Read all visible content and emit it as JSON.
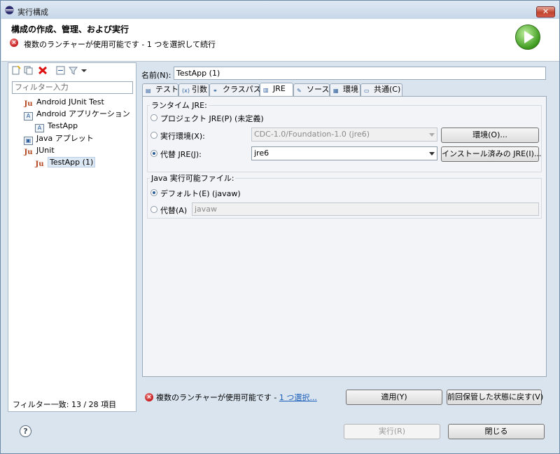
{
  "window": {
    "title": "実行構成",
    "close_glyph": "✕"
  },
  "header": {
    "title": "構成の作成、管理、および実行",
    "message": "複数のランチャーが使用可能です - 1 つを選択して続行"
  },
  "sidebar": {
    "filter_placeholder": "フィルター入力",
    "items": [
      {
        "label": "Android JUnit Test",
        "icon": "junit-icon"
      },
      {
        "label": "Android アプリケーション",
        "icon": "android-app-icon"
      },
      {
        "label": "TestApp",
        "icon": "android-app-icon"
      },
      {
        "label": "Java アプレット",
        "icon": "applet-icon"
      },
      {
        "label": "JUnit",
        "icon": "junit-icon"
      },
      {
        "label": "TestApp (1)",
        "icon": "junit-icon",
        "selected": true
      }
    ],
    "status": "フィルター一致: 13 / 28 項目"
  },
  "config": {
    "name_label": "名前(N):",
    "name_value": "TestApp (1)",
    "tabs": [
      {
        "label": "テスト",
        "icon": "test-icon"
      },
      {
        "label": "引数",
        "icon": "arguments-icon"
      },
      {
        "label": "クラスパス",
        "icon": "classpath-icon"
      },
      {
        "label": "JRE",
        "icon": "jre-icon",
        "active": true
      },
      {
        "label": "ソース",
        "icon": "source-icon"
      },
      {
        "label": "環境",
        "icon": "environment-icon"
      },
      {
        "label": "共通(C)",
        "icon": "common-icon"
      }
    ],
    "runtime_group": {
      "title": "ランタイム JRE:",
      "project_jre_label": "プロジェクト JRE(P) (未定義)",
      "exec_env_label": "実行環境(X):",
      "exec_env_value": "CDC-1.0/Foundation-1.0 (jre6)",
      "env_button": "環境(O)...",
      "alt_jre_label": "代替 JRE(J):",
      "alt_jre_value": "jre6",
      "installed_jre_button": "インストール済みの JRE(I)..."
    },
    "exec_group": {
      "title": "Java 実行可能ファイル:",
      "default_label": "デフォルト(E) (javaw)",
      "alt_label": "代替(A)",
      "alt_value": "javaw"
    },
    "status_message": "複数のランチャーが使用可能です - ",
    "status_link": "1 つ選択...",
    "apply_button": "適用(Y)",
    "revert_button": "前回保管した状態に戻す(V)"
  },
  "footer": {
    "help_glyph": "?",
    "run_button": "実行(R)",
    "close_button": "閉じる"
  },
  "colors": {
    "accent": "#2a5c9c",
    "error": "#c41a1a",
    "run": "#3e9b1e"
  }
}
